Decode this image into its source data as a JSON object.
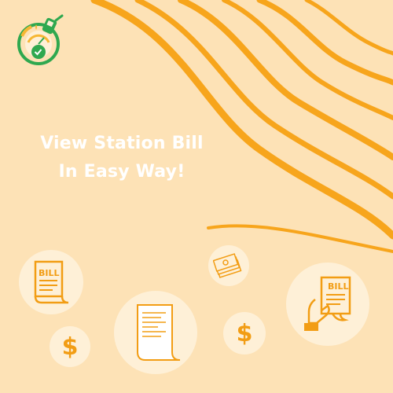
{
  "brand": {
    "logo_name": "fuel-station-check-logo",
    "colors": {
      "green": "#2fa84f",
      "amber": "#f7b733",
      "orange": "#f29d14",
      "background": "#fde2b6"
    }
  },
  "headline": {
    "line1": "View Station Bill",
    "line2": "In Easy Way!"
  },
  "illustrations": {
    "bill_doc_label": "BILL",
    "bill_hand_label": "BILL",
    "dollar_symbol": "$"
  }
}
